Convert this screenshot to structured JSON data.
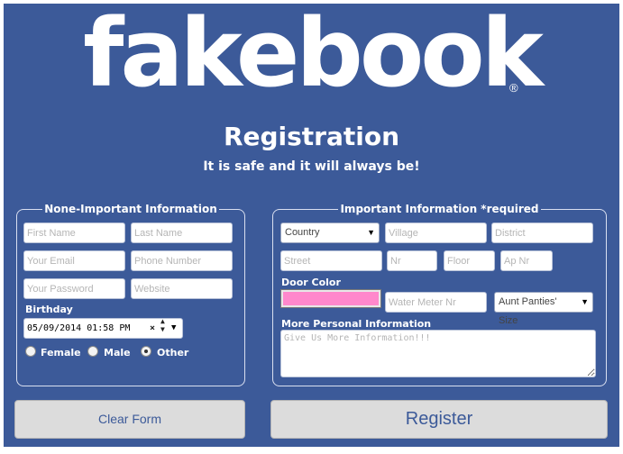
{
  "header": {
    "logo": "fakebook",
    "logo_mark": "®",
    "title": "Registration",
    "subtitle": "It is safe and it will always be!"
  },
  "left_section": {
    "legend": "None-Important Information",
    "first_name_placeholder": "First Name",
    "last_name_placeholder": "Last Name",
    "email_placeholder": "Your Email",
    "phone_placeholder": "Phone Number",
    "password_placeholder": "Your Password",
    "website_placeholder": "Website",
    "birthday_label": "Birthday",
    "birthday_value": "05/09/2014 01:58 PM",
    "genders": [
      {
        "label": "Female",
        "selected": false
      },
      {
        "label": "Male",
        "selected": false
      },
      {
        "label": "Other",
        "selected": true
      }
    ]
  },
  "right_section": {
    "legend": "Important Information *required",
    "country_value": "Country",
    "village_placeholder": "Village",
    "district_placeholder": "District",
    "street_placeholder": "Street",
    "nr_placeholder": "Nr",
    "floor_placeholder": "Floor",
    "apnr_placeholder": "Ap Nr",
    "door_color_label": "Door Color",
    "door_color_value": "#ff88cc",
    "water_meter_placeholder": "Water Meter Nr",
    "aunt_size_value": "Aunt Panties' Size",
    "more_info_label": "More Personal Information",
    "more_info_placeholder": "Give Us More Information!!!"
  },
  "buttons": {
    "clear_label": "Clear Form",
    "register_label": "Register"
  },
  "colors": {
    "background": "#3c5a99",
    "button_bg": "#dcdcdc",
    "button_text": "#3c5a99"
  }
}
